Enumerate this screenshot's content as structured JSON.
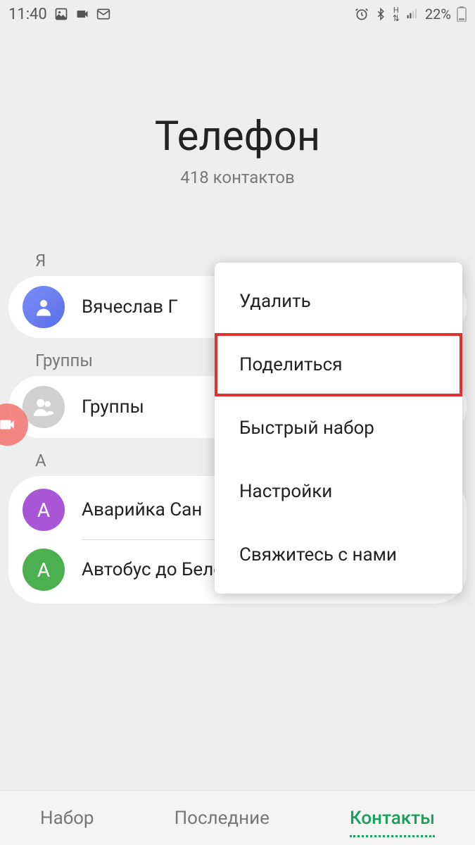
{
  "status_bar": {
    "time": "11:40",
    "battery": "22%"
  },
  "header": {
    "title": "Телефон",
    "subtitle": "418 контактов"
  },
  "sections": {
    "me_label": "Я",
    "groups_label": "Группы",
    "a_label": "A"
  },
  "contacts": {
    "me_name": "Вячеслав Г",
    "groups_name": "Группы",
    "a_items": [
      {
        "initial": "A",
        "name": "Аварийка Сан"
      },
      {
        "initial": "A",
        "name": "Автобус до Белокурихи"
      }
    ]
  },
  "menu": {
    "items": [
      "Удалить",
      "Поделиться",
      "Быстрый набор",
      "Настройки",
      "Свяжитесь с нами"
    ]
  },
  "tabs": {
    "dial": "Набор",
    "recent": "Последние",
    "contacts": "Контакты"
  }
}
